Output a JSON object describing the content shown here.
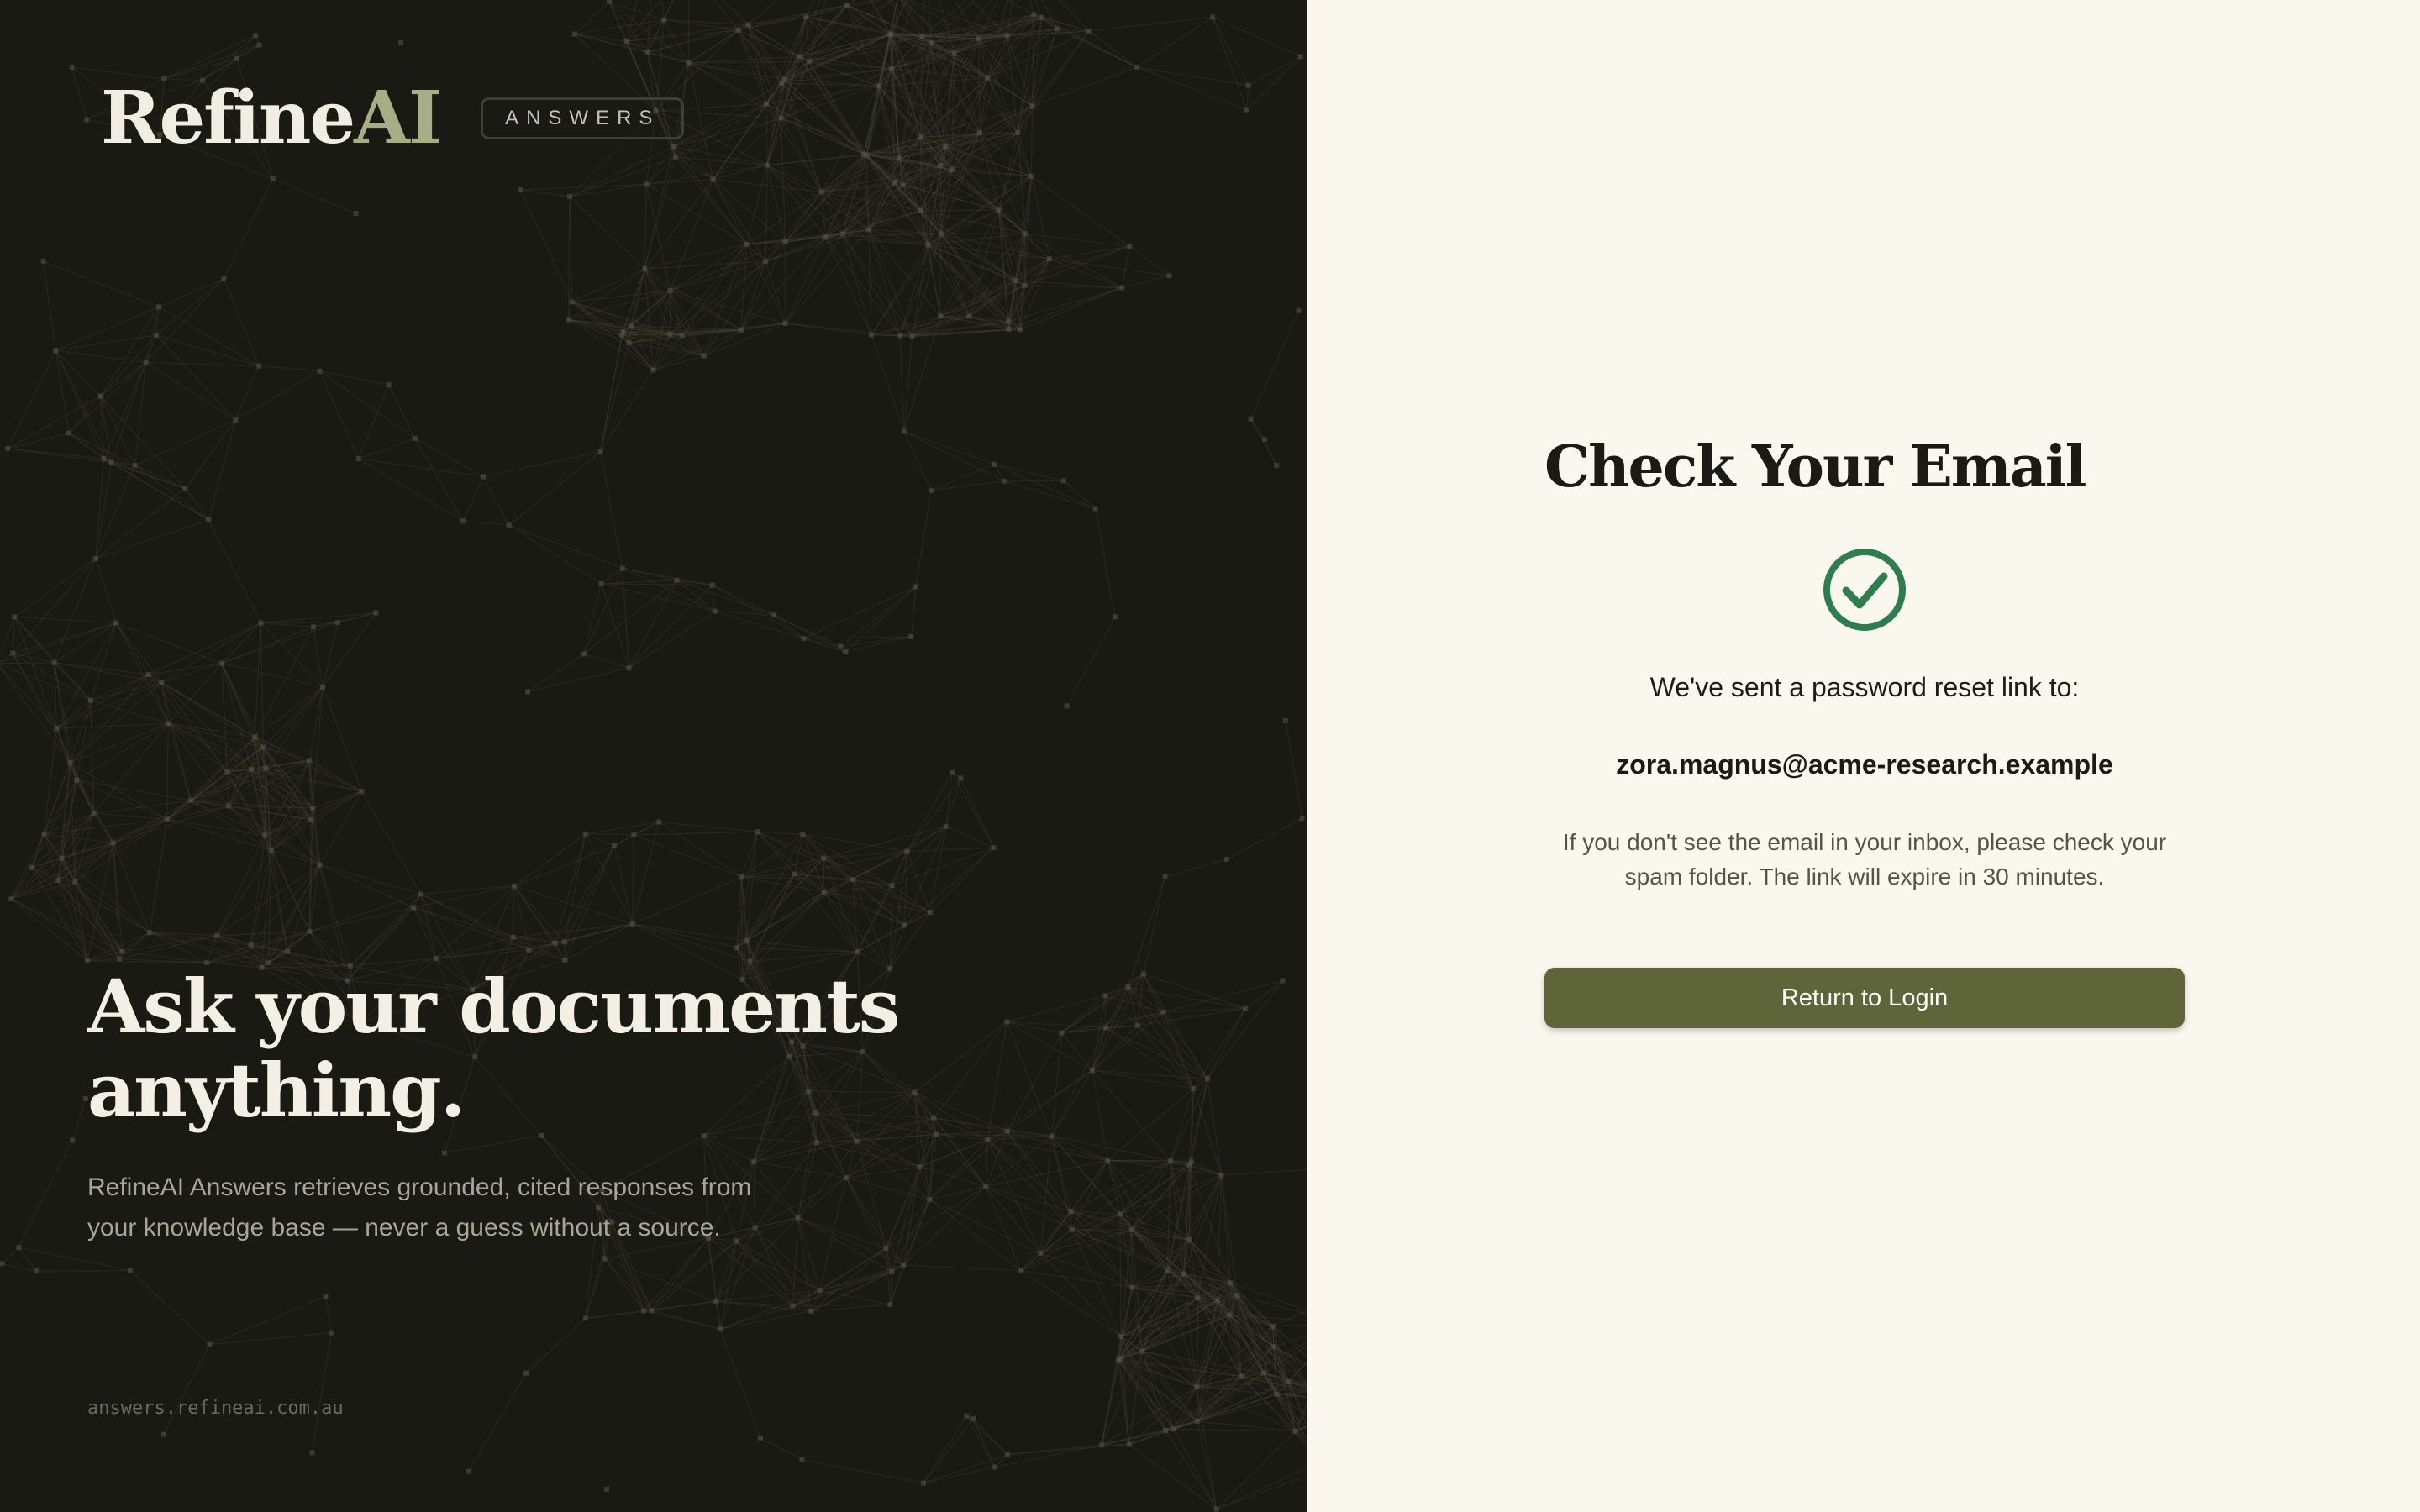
{
  "brand": {
    "logo_main": "Refine",
    "logo_accent": "AI",
    "product_tag": "ANSWERS"
  },
  "hero": {
    "headline_line1": "Ask your documents",
    "headline_line2": "anything.",
    "subtext": "RefineAI Answers retrieves grounded, cited responses from your knowledge base — never a guess without a source."
  },
  "footer": {
    "url": "answers.refineai.com.au"
  },
  "confirmation": {
    "title": "Check Your Email",
    "icon": "check-circle-icon",
    "sent_message": "We've sent a password reset link to:",
    "email": "zora.magnus@acme-research.example",
    "note": "If you don't see the email in your inbox, please check your spam folder. The link will expire in 30 minutes.",
    "button_label": "Return to Login"
  },
  "colors": {
    "panel_dark": "#1a1a14",
    "panel_light": "#faf8ee",
    "accent_olive": "#5e6538",
    "logo_accent": "#a7ad84",
    "success_green": "#2e7d4f"
  }
}
